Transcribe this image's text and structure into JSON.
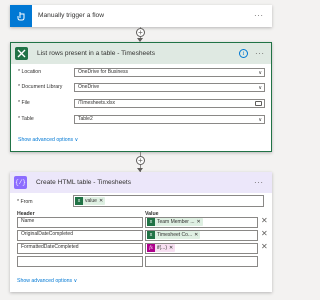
{
  "colors": {
    "trigger_blue": "#0078d4",
    "excel_green": "#217346",
    "html_purple": "#8c6cff",
    "expr_pink": "#ad008c",
    "link_blue": "#0078d4"
  },
  "trigger": {
    "title": "Manually trigger a flow",
    "icon": "hand-touch-icon",
    "menu": "···"
  },
  "excel": {
    "title": "List rows present in a table - Timesheets",
    "icon": "excel-icon",
    "info_icon": "info-icon",
    "menu": "···",
    "fields": [
      {
        "label": "* Location",
        "value": "OneDrive for Business",
        "kind": "dropdown"
      },
      {
        "label": "* Document Library",
        "value": "OneDrive",
        "kind": "dropdown"
      },
      {
        "label": "* File",
        "value": "/Timesheets.xlsx",
        "kind": "folder"
      },
      {
        "label": "* Table",
        "value": "Table2",
        "kind": "dropdown"
      }
    ],
    "advanced": "Show advanced options ∨"
  },
  "html": {
    "title": "Create HTML table - Timesheets",
    "icon": "code-braces-icon",
    "menu": "···",
    "from_label": "* From",
    "from_token": "value",
    "header_col": "Header",
    "value_col": "Value",
    "rows": [
      {
        "header": "Name",
        "token": "Team Member ...",
        "token_kind": "excel"
      },
      {
        "header": "OriginalDateCompleted",
        "token": "Timesheet Co...",
        "token_kind": "excel"
      },
      {
        "header": "FormattedDateCompleted",
        "token": "if(...)",
        "token_kind": "expression"
      }
    ],
    "advanced": "Show advanced options ∨"
  }
}
